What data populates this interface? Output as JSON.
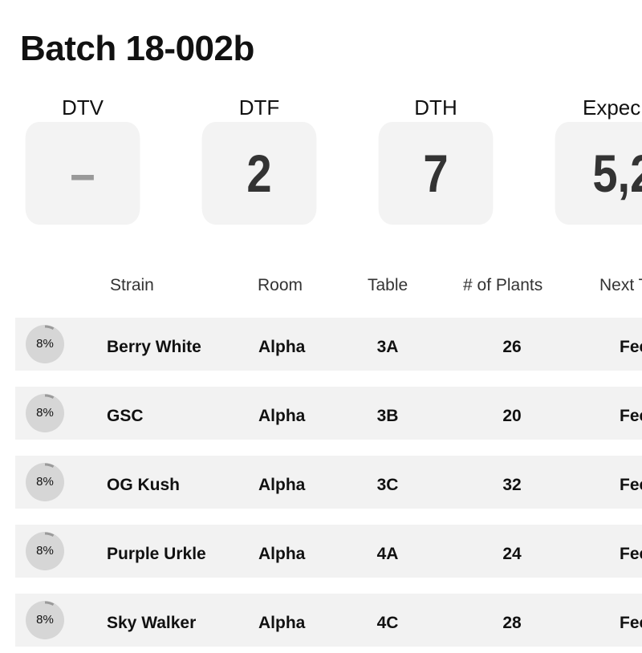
{
  "title": "Batch 18-002b",
  "stats": [
    {
      "label": "DTV",
      "value": "–"
    },
    {
      "label": "DTF",
      "value": "2"
    },
    {
      "label": "DTH",
      "value": "7"
    },
    {
      "label": "Expec",
      "value": "5,2"
    }
  ],
  "columns": {
    "strain": "Strain",
    "room": "Room",
    "table": "Table",
    "plants": "# of Plants",
    "next": "Next T"
  },
  "rows": [
    {
      "progress": "8%",
      "progress_value": 8,
      "strain": "Berry White",
      "room": "Alpha",
      "table": "3A",
      "plants": "26",
      "next": "Fee"
    },
    {
      "progress": "8%",
      "progress_value": 8,
      "strain": "GSC",
      "room": "Alpha",
      "table": "3B",
      "plants": "20",
      "next": "Fee"
    },
    {
      "progress": "8%",
      "progress_value": 8,
      "strain": "OG Kush",
      "room": "Alpha",
      "table": "3C",
      "plants": "32",
      "next": "Fee"
    },
    {
      "progress": "8%",
      "progress_value": 8,
      "strain": "Purple Urkle",
      "room": "Alpha",
      "table": "4A",
      "plants": "24",
      "next": "Fee"
    },
    {
      "progress": "8%",
      "progress_value": 8,
      "strain": "Sky Walker",
      "room": "Alpha",
      "table": "4C",
      "plants": "28",
      "next": "Fee"
    }
  ]
}
